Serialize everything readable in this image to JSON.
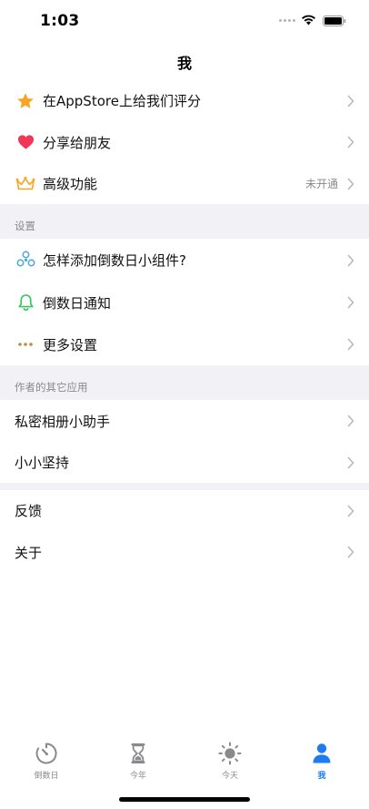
{
  "status_bar": {
    "time": "1:03"
  },
  "nav": {
    "title": "我"
  },
  "group1": [
    {
      "label": "在AppStore上给我们评分",
      "icon": "star-icon"
    },
    {
      "label": "分享给朋友",
      "icon": "heart-icon"
    },
    {
      "label": "高级功能",
      "icon": "crown-icon",
      "trailing": "未开通"
    }
  ],
  "section_settings": {
    "title": "设置"
  },
  "group2": [
    {
      "label": "怎样添加倒数日小组件?",
      "icon": "widget-icon"
    },
    {
      "label": "倒数日通知",
      "icon": "bell-icon"
    },
    {
      "label": "更多设置",
      "icon": "more-dots-icon"
    }
  ],
  "section_apps": {
    "title": "作者的其它应用"
  },
  "group3": [
    {
      "label": "私密相册小助手"
    },
    {
      "label": "小小坚持"
    }
  ],
  "group4": [
    {
      "label": "反馈"
    },
    {
      "label": "关于"
    }
  ],
  "tabbar": [
    {
      "label": "倒数日",
      "icon": "timer-icon",
      "active": false
    },
    {
      "label": "今年",
      "icon": "hourglass-icon",
      "active": false
    },
    {
      "label": "今天",
      "icon": "sun-icon",
      "active": false
    },
    {
      "label": "我",
      "icon": "person-icon",
      "active": true
    }
  ],
  "colors": {
    "accent": "#1e7cf0",
    "section_bg": "#f1f1f6",
    "secondary_text": "#8a8a8e",
    "star": "#f5a623",
    "heart": "#f23658",
    "crown": "#f5a623",
    "bell": "#34c759",
    "widget": "#4aa8d8",
    "dots": "#c8893c"
  }
}
